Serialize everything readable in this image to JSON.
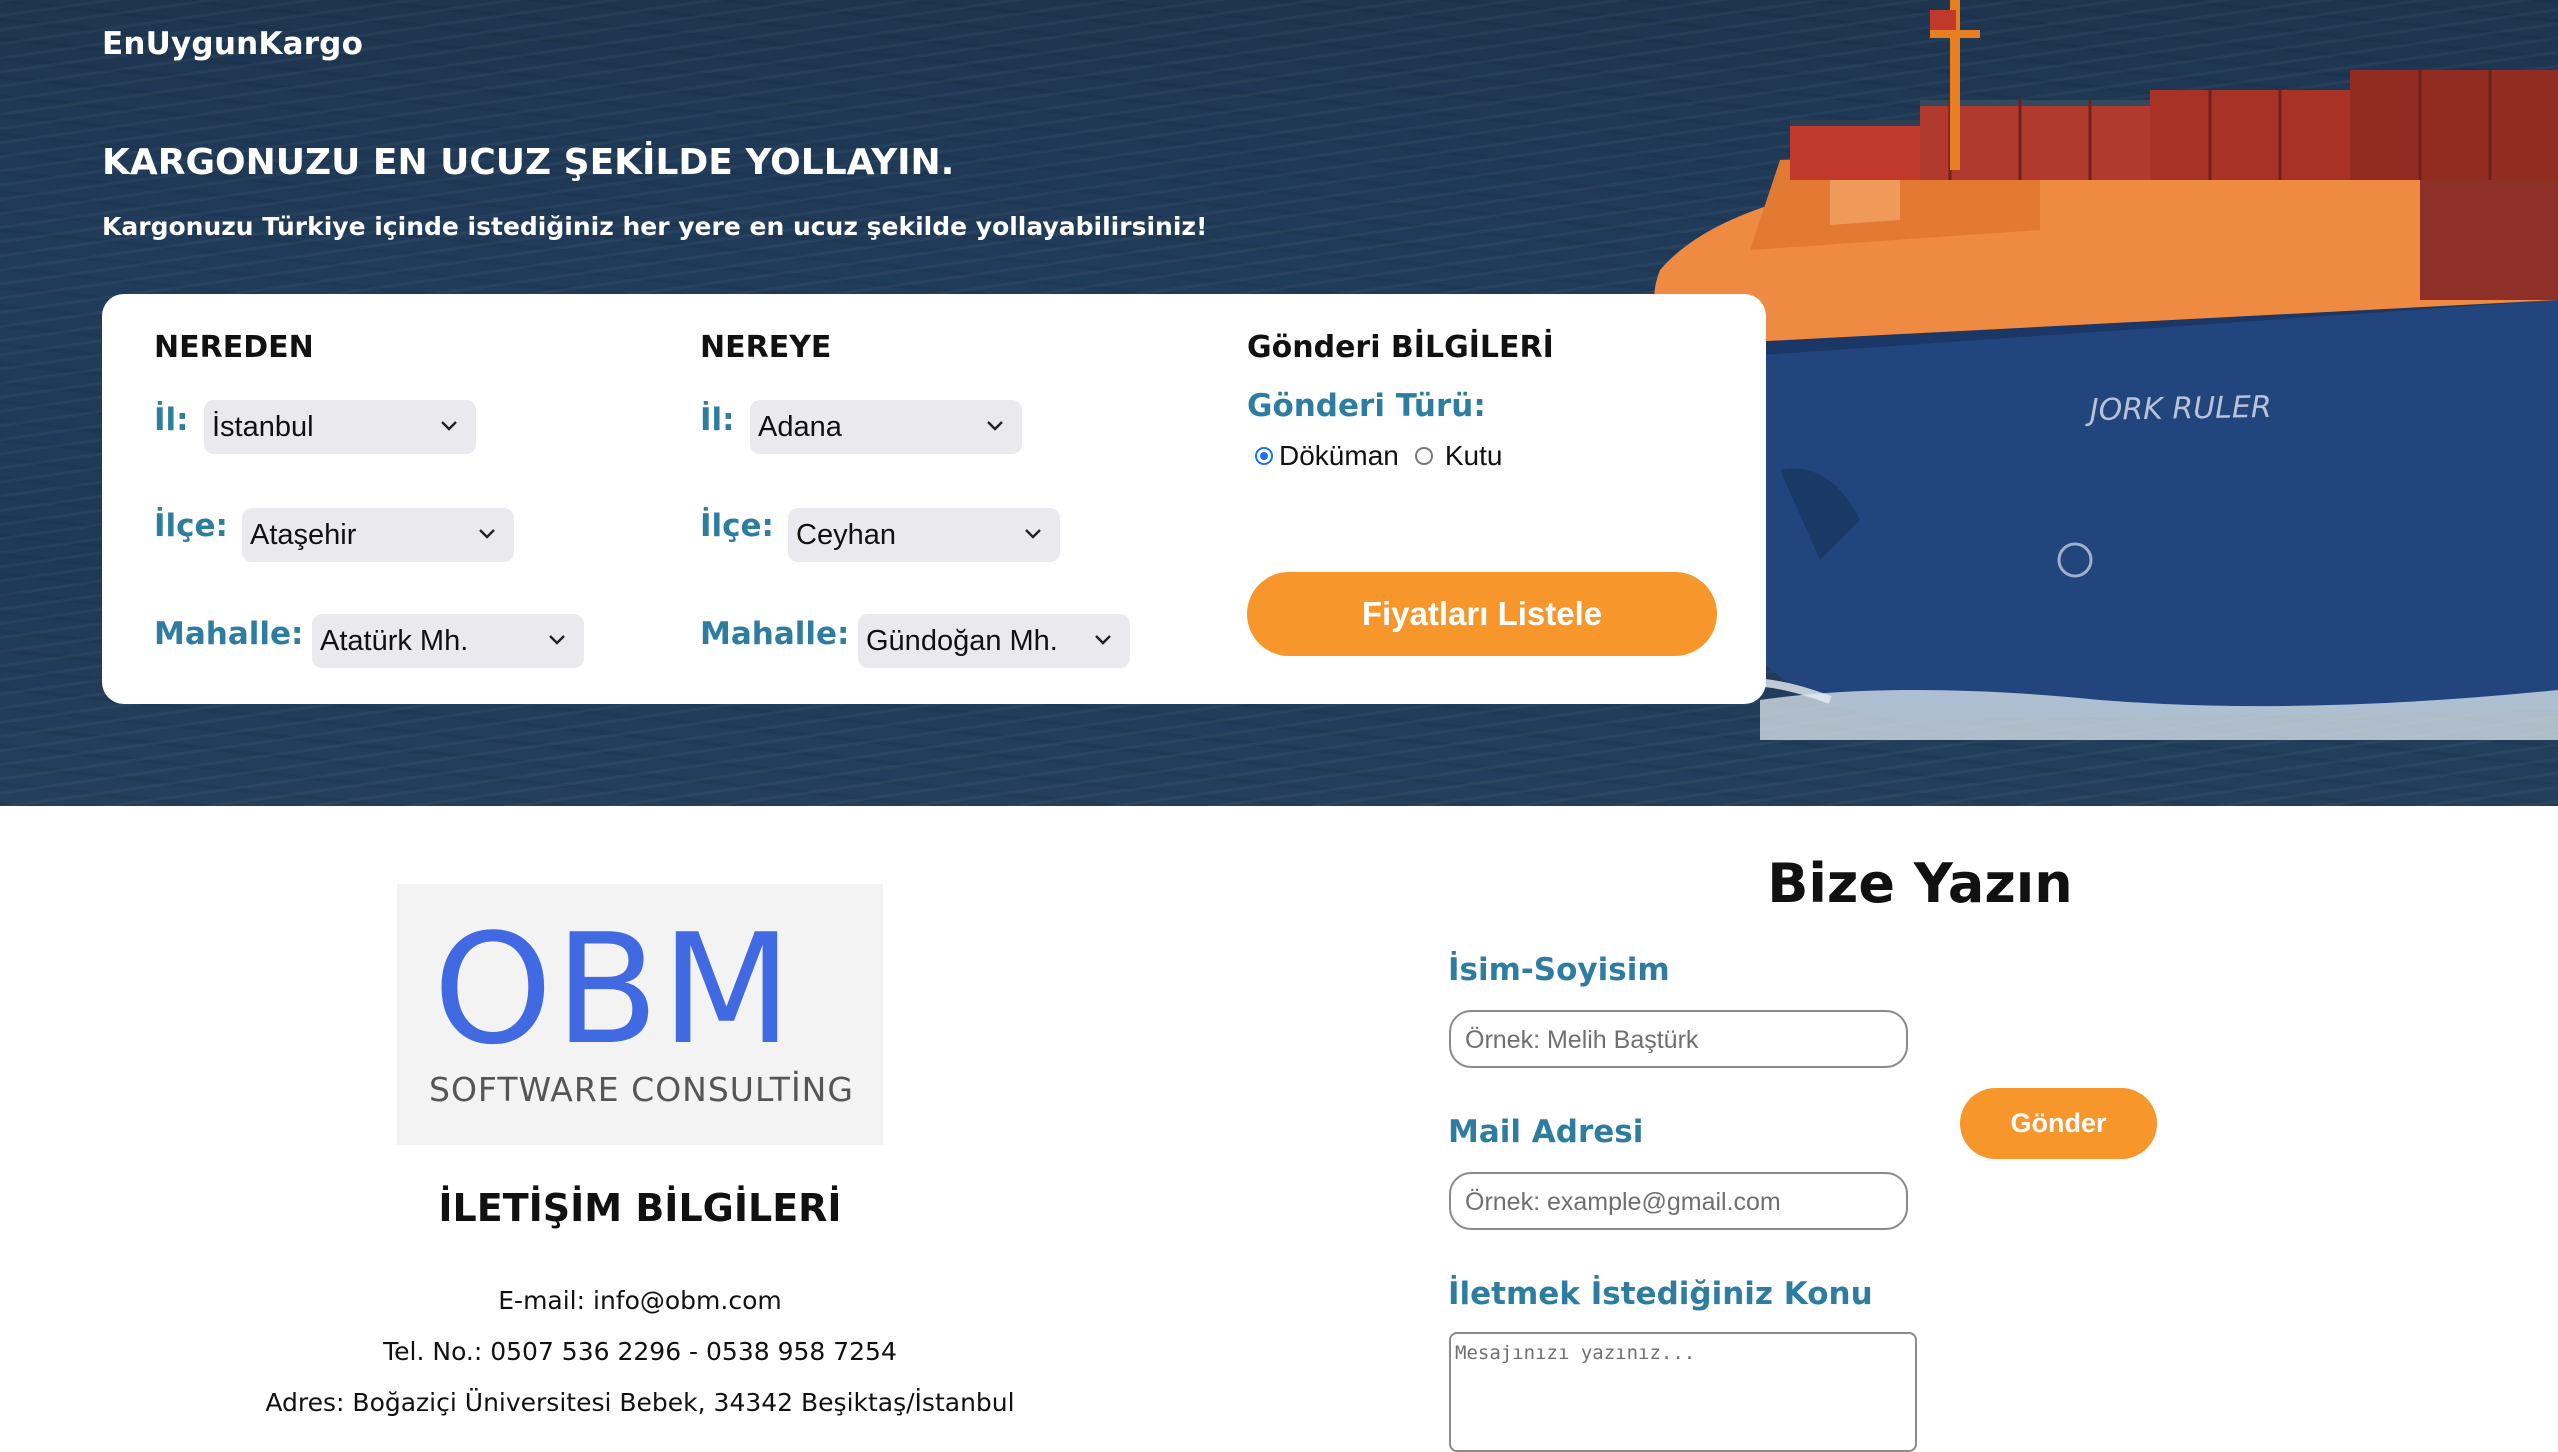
{
  "brand": "EnUygunKargo",
  "hero": {
    "title": "KARGONUZU EN UCUZ ŞEKİLDE YOLLAYIN.",
    "subtitle": "Kargonuzu Türkiye içinde istediğiniz her yere en ucuz şekilde yollayabilirsiniz!",
    "ship_name": "JORK RULER"
  },
  "search": {
    "from": {
      "heading": "NEREDEN",
      "il_label": "İl:",
      "il_value": "İstanbul",
      "ilce_label": "İlçe:",
      "ilce_value": "Ataşehir",
      "mahalle_label": "Mahalle:",
      "mahalle_value": "Atatürk Mh."
    },
    "to": {
      "heading": "NEREYE",
      "il_label": "İl:",
      "il_value": "Adana",
      "ilce_label": "İlçe:",
      "ilce_value": "Ceyhan",
      "mahalle_label": "Mahalle:",
      "mahalle_value": "Gündoğan Mh."
    },
    "shipment": {
      "heading": "Gönderi BİLGİLERİ",
      "type_label": "Gönderi Türü:",
      "options": [
        "Döküman",
        "Kutu"
      ],
      "selected": "Döküman"
    },
    "list_button": "Fiyatları Listele"
  },
  "logo": {
    "main": "OBM",
    "sub": "SOFTWARE CONSULTİNG"
  },
  "contact": {
    "title": "İLETİŞİM BİLGİLERİ",
    "email": "E-mail: info@obm.com",
    "phone": "Tel. No.: 0507 536 2296 - 0538 958 7254",
    "address": "Adres: Boğaziçi Üniversitesi Bebek, 34342 Beşiktaş/İstanbul"
  },
  "form": {
    "title": "Bize Yazın",
    "name_label": "İsim-Soyisim",
    "name_placeholder": "Örnek: Melih Baştürk",
    "mail_label": "Mail Adresi",
    "mail_placeholder": "Örnek: example@gmail.com",
    "subject_label": "İletmek İstediğiniz Konu",
    "message_placeholder": "Mesajınızı yazınız...",
    "send_button": "Gönder"
  },
  "colors": {
    "accent": "#f7962b",
    "label": "#2e7da0",
    "logo_blue": "#4169e1"
  }
}
